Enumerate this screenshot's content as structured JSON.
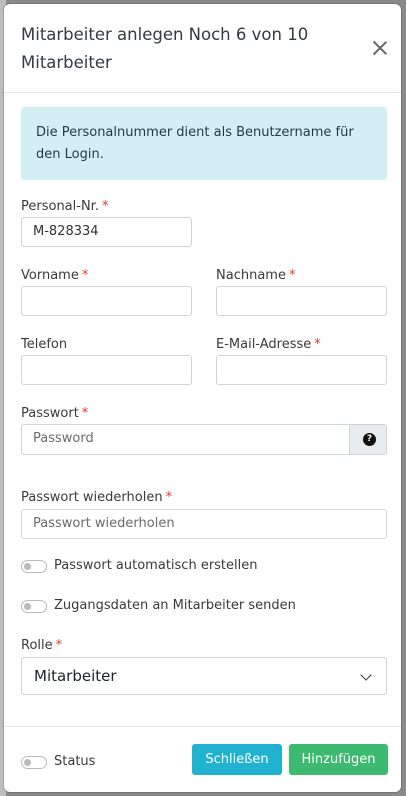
{
  "modal": {
    "title": "Mitarbeiter anlegen  Noch 6 von 10 Mitarbeiter",
    "info": "Die Personalnummer dient als Benutzername für den Login."
  },
  "form": {
    "personal_nr": {
      "label": "Personal-Nr.",
      "value": "M-828334",
      "required": "*"
    },
    "vorname": {
      "label": "Vorname",
      "value": "",
      "required": "*"
    },
    "nachname": {
      "label": "Nachname",
      "value": "",
      "required": "*"
    },
    "telefon": {
      "label": "Telefon",
      "value": ""
    },
    "email": {
      "label": "E-Mail-Adresse",
      "value": "",
      "required": "*"
    },
    "passwort": {
      "label": "Passwort",
      "placeholder": "Password",
      "required": "*"
    },
    "passwort_wiederholen": {
      "label": "Passwort wiederholen",
      "placeholder": "Passwort wiederholen",
      "required": "*"
    },
    "auto_pw": {
      "label": "Passwort automatisch erstellen",
      "checked": false
    },
    "send_access": {
      "label": "Zugangsdaten an Mitarbeiter senden",
      "checked": false
    },
    "rolle": {
      "label": "Rolle",
      "value": "Mitarbeiter",
      "required": "*"
    }
  },
  "footer": {
    "status_label": "Status",
    "status_checked": false,
    "close_label": "Schließen",
    "add_label": "Hinzufügen"
  },
  "colors": {
    "info_bg": "#d3eef4",
    "close_button": "#20b2cf",
    "add_button": "#3cba6f",
    "required": "#e3342f"
  },
  "icons": {
    "close": "close-icon",
    "help": "question-circle-icon",
    "chevron": "chevron-down-icon"
  }
}
